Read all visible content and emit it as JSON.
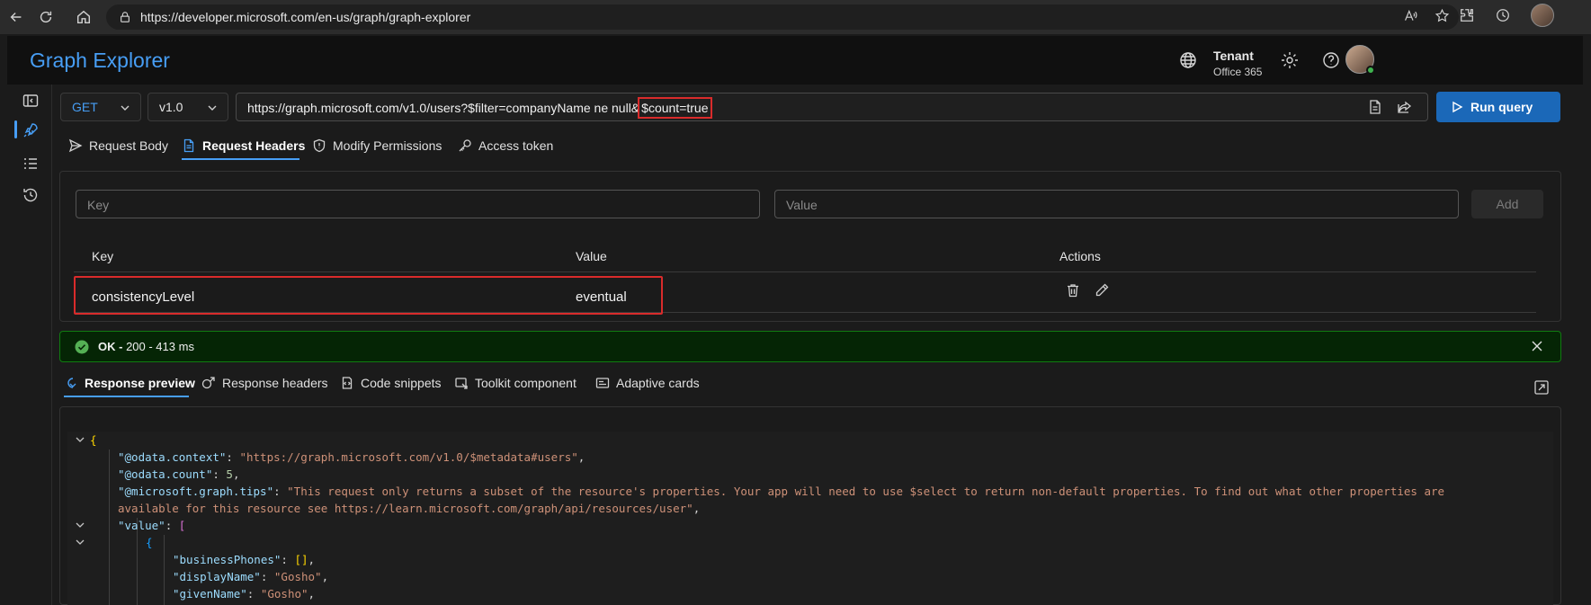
{
  "browser": {
    "url": "https://developer.microsoft.com/en-us/graph/graph-explorer"
  },
  "header": {
    "title": "Graph Explorer",
    "tenant_label": "Tenant",
    "tenant_name": "Office 365"
  },
  "query": {
    "method": "GET",
    "version": "v1.0",
    "url_prefix": "https://graph.microsoft.com/v1.0/users?$filter=companyName ne null&",
    "url_highlight": "$count=true",
    "run_label": "Run query"
  },
  "request_tabs": [
    {
      "label": "Request Body",
      "icon": "send-icon"
    },
    {
      "label": "Request Headers",
      "icon": "document-icon",
      "active": true
    },
    {
      "label": "Modify Permissions",
      "icon": "shield-icon"
    },
    {
      "label": "Access token",
      "icon": "key-icon"
    }
  ],
  "headers_form": {
    "key_placeholder": "Key",
    "value_placeholder": "Value",
    "add_label": "Add",
    "columns": [
      "Key",
      "Value",
      "Actions"
    ],
    "rows": [
      {
        "key": "consistencyLevel",
        "value": "eventual"
      }
    ]
  },
  "status": {
    "ok_label": "OK -",
    "detail": " 200 - 413 ms"
  },
  "response_tabs": [
    {
      "label": "Response preview",
      "icon": "preview-icon",
      "active": true
    },
    {
      "label": "Response headers",
      "icon": "headers-icon"
    },
    {
      "label": "Code snippets",
      "icon": "code-icon"
    },
    {
      "label": "Toolkit component",
      "icon": "toolkit-icon"
    },
    {
      "label": "Adaptive cards",
      "icon": "card-icon"
    }
  ],
  "response": {
    "context_key": "\"@odata.context\"",
    "context_val": "\"https://graph.microsoft.com/v1.0/$metadata#users\"",
    "count_key": "\"@odata.count\"",
    "count_val": "5",
    "tips_key": "\"@microsoft.graph.tips\"",
    "tips_val_1": "\"This request only returns a subset of the resource's properties. Your app will need to use $select to return non-default properties. To find out what other properties are",
    "tips_val_2": "available for this resource see https://learn.microsoft.com/graph/api/resources/user\"",
    "value_key": "\"value\"",
    "bp_key": "\"businessPhones\"",
    "dn_key": "\"displayName\"",
    "dn_val": "\"Gosho\"",
    "gn_key": "\"givenName\"",
    "gn_val": "\"Gosho\""
  },
  "colors": {
    "accent": "#479ef5",
    "run_button": "#1b68b8",
    "success_bg": "#052505",
    "highlight_border": "#d92b2b"
  }
}
